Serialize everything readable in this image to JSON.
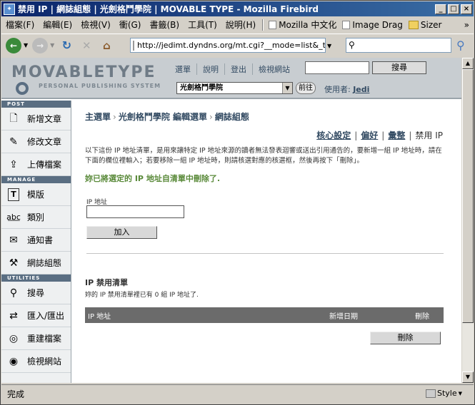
{
  "window": {
    "title": "禁用 IP | 網誌組態 | 光劍格鬥學院 | MOVABLE TYPE - Mozilla Firebird",
    "minimize": "_",
    "maximize": "□",
    "close": "×"
  },
  "menu": {
    "items": [
      "檔案(F)",
      "編輯(E)",
      "檢視(V)",
      "衝(G)",
      "書籤(B)",
      "工具(T)",
      "說明(H)"
    ],
    "bookmarks": [
      "Mozilla 中文化",
      "Image Drag",
      "Sizer"
    ],
    "more": "»"
  },
  "nav": {
    "url": "http://jedimt.dyndns.org/mt.cgi?__mode=list&_type=",
    "search_value": ""
  },
  "mt": {
    "logo_title": "MOVABLETYPE",
    "logo_subtitle": "PERSONAL PUBLISHING SYSTEM",
    "top_links": [
      "選單",
      "說明",
      "登出",
      "檢視網站"
    ],
    "search_button": "搜尋",
    "blog_select": "光劍格鬥學院",
    "go_button": "前往",
    "user_label": "使用者:",
    "user_name": "Jedi"
  },
  "sidebar": {
    "sections": [
      {
        "header": "POST",
        "items": [
          "新增文章",
          "修改文章",
          "上傳檔案"
        ]
      },
      {
        "header": "MANAGE",
        "items": [
          "模版",
          "類別",
          "通知書",
          "網誌組態"
        ]
      },
      {
        "header": "UTILITIES",
        "items": [
          "搜尋",
          "匯入/匯出",
          "重建檔案",
          "檢視網站"
        ]
      }
    ]
  },
  "main": {
    "breadcrumb": [
      "主選單",
      "光劍格鬥學院 編輯選單",
      "網誌組態"
    ],
    "tabs": [
      "核心設定",
      "偏好",
      "彙整",
      "禁用 IP"
    ],
    "description": "以下這份 IP 地址清單，是用來讓特定 IP 地址來源的讀者無法發表迴響或送出引用通告的，要新增一組 IP 地址時，請在下面的欄位裡輸入；若要移除一組 IP 地址時，則請核選對應的核選框，然後再按下「刪除」。",
    "message": "妳已將選定的 IP 地址自清單中刪除了.",
    "ip_label": "IP 地址",
    "ip_value": "",
    "add_button": "加入",
    "ban_title": "IP 禁用清單",
    "ban_subtitle": "妳的 IP 禁用清單裡已有 0 組 IP 地址了.",
    "table_headers": [
      "IP 地址",
      "新增日期",
      "刪除"
    ],
    "delete_button": "刪除"
  },
  "status": {
    "text": "完成",
    "style_label": "Style"
  },
  "colors": {
    "titlebar": "#0a246a",
    "mt_header": "#c8cdd1",
    "sidebar_section": "#5a6e82",
    "success_message": "#5a8a3a",
    "table_header": "#6b6b6b"
  }
}
